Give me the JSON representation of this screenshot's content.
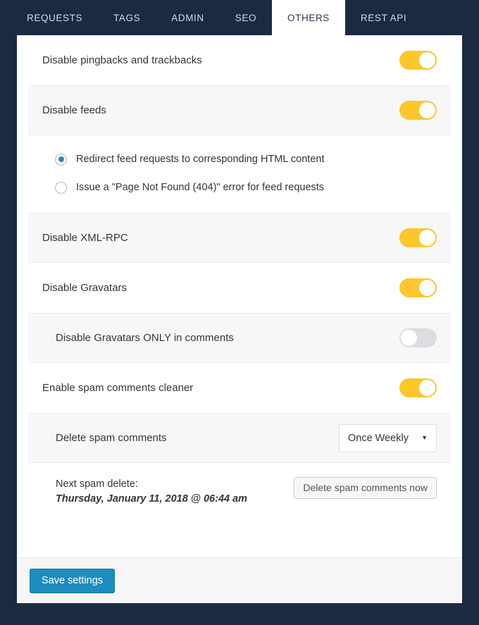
{
  "tabs": [
    {
      "label": "REQUESTS",
      "active": false
    },
    {
      "label": "TAGS",
      "active": false
    },
    {
      "label": "ADMIN",
      "active": false
    },
    {
      "label": "SEO",
      "active": false
    },
    {
      "label": "OTHERS",
      "active": true
    },
    {
      "label": "REST API",
      "active": false
    }
  ],
  "settings": {
    "pingbacks": {
      "label": "Disable pingbacks and trackbacks",
      "state": "on"
    },
    "feeds": {
      "label": "Disable feeds",
      "state": "on"
    },
    "feed_options": [
      {
        "label": "Redirect feed requests to corresponding HTML content",
        "selected": true
      },
      {
        "label": "Issue a \"Page Not Found (404)\" error for feed requests",
        "selected": false
      }
    ],
    "xmlrpc": {
      "label": "Disable XML-RPC",
      "state": "on"
    },
    "gravatars": {
      "label": "Disable Gravatars",
      "state": "on"
    },
    "gravatars_comments": {
      "label": "Disable Gravatars ONLY in comments",
      "state": "off"
    },
    "spam_cleaner": {
      "label": "Enable spam comments cleaner",
      "state": "on"
    },
    "delete_spam": {
      "label": "Delete spam comments",
      "value": "Once Weekly",
      "arrow": "▼"
    },
    "next_delete": {
      "title": "Next spam delete:",
      "date": "Thursday, January 11, 2018 @ 06:44 am",
      "button_label": "Delete spam comments now"
    }
  },
  "footer": {
    "save_label": "Save settings"
  },
  "colors": {
    "toggle_on": "#fcc62d",
    "toggle_off": "#dcdde0",
    "primary_button": "#1e8cbe",
    "radio_dot": "#1e8cbe",
    "chrome": "#1b2a41"
  }
}
